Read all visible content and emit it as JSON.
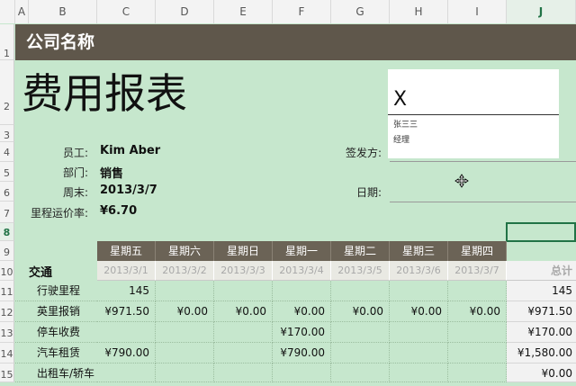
{
  "columns": [
    "A",
    "B",
    "C",
    "D",
    "E",
    "F",
    "G",
    "H",
    "I",
    "J"
  ],
  "rows": [
    "1",
    "2",
    "3",
    "4",
    "5",
    "6",
    "7",
    "8",
    "9",
    "10",
    "11",
    "12",
    "13",
    "14",
    "15"
  ],
  "title_bar": "公司名称",
  "report_title": "费用报表",
  "signature": {
    "mark": "X",
    "name": "张三三",
    "role": "经理"
  },
  "fields": {
    "employee_label": "员工:",
    "employee_value": "Kim Aber",
    "dept_label": "部门:",
    "dept_value": "销售",
    "week_label": "周末:",
    "week_value": "2013/3/7",
    "mileage_label": "里程运价率:",
    "mileage_value": "¥6.70",
    "issuer_label": "签发方:",
    "date_label": "日期:"
  },
  "table": {
    "section": "交通",
    "days": [
      "星期五",
      "星期六",
      "星期日",
      "星期一",
      "星期二",
      "星期三",
      "星期四"
    ],
    "dates": [
      "2013/3/1",
      "2013/3/2",
      "2013/3/3",
      "2013/3/4",
      "2013/3/5",
      "2013/3/6",
      "2013/3/7"
    ],
    "total_header": "总计",
    "rows": [
      {
        "label": "行驶里程",
        "values": [
          "145",
          "",
          "",
          "",
          "",
          "",
          ""
        ],
        "total": "145"
      },
      {
        "label": "英里报销",
        "values": [
          "¥971.50",
          "¥0.00",
          "¥0.00",
          "¥0.00",
          "¥0.00",
          "¥0.00",
          "¥0.00"
        ],
        "total": "¥971.50"
      },
      {
        "label": "停车收费",
        "values": [
          "",
          "",
          "",
          "¥170.00",
          "",
          "",
          ""
        ],
        "total": "¥170.00"
      },
      {
        "label": "汽车租赁",
        "values": [
          "¥790.00",
          "",
          "",
          "¥790.00",
          "",
          "",
          ""
        ],
        "total": "¥1,580.00"
      },
      {
        "label": "出租车/轿车",
        "values": [
          "",
          "",
          "",
          "",
          "",
          "",
          ""
        ],
        "total": "¥0.00"
      }
    ]
  },
  "colors": {
    "header_bar": "#5f574b",
    "background": "#c6e7cd",
    "day_header": "#6b6356"
  }
}
